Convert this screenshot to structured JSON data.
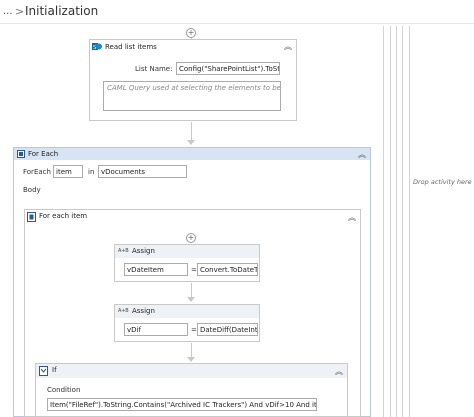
{
  "breadcrumb": {
    "ellipsis": "...",
    "separator": ">",
    "title": "Initialization"
  },
  "read_list_items": {
    "title": "Read list items",
    "list_name_label": "List Name:",
    "list_name_value": "Config(\"SharePointList\").ToStri",
    "caml_placeholder": "CAML Query used at selecting the elements to be proces"
  },
  "for_each": {
    "title": "For Each",
    "foreach_label": "ForEach",
    "item_value": "item",
    "in_label": "in",
    "collection_value": "vDocuments",
    "body_label": "Body"
  },
  "for_each_item": {
    "title": "For each item"
  },
  "assign_1": {
    "title": "Assign",
    "left_value": "vDateItem",
    "equals": "=",
    "right_value": "Convert.ToDateTim"
  },
  "assign_2": {
    "title": "Assign",
    "left_value": "vDif",
    "equals": "=",
    "right_value": "DateDiff(DateInten"
  },
  "if_activity": {
    "title": "If",
    "condition_label": "Condition",
    "condition_value": "Item(\"FileRef\").ToString.Contains(\"Archived IC Trackers\") And vDif>10 And item(\"File"
  },
  "drop_zone_text": "Drop activity here",
  "colors": {
    "container_header": "#d6e4f4",
    "border": "#c9c9c9",
    "accent": "#2b579a"
  },
  "icons": [
    "chevron-right-icon",
    "add-activity-icon",
    "collapse-icon",
    "sharepoint-icon",
    "for-each-icon",
    "assign-icon",
    "if-icon"
  ]
}
